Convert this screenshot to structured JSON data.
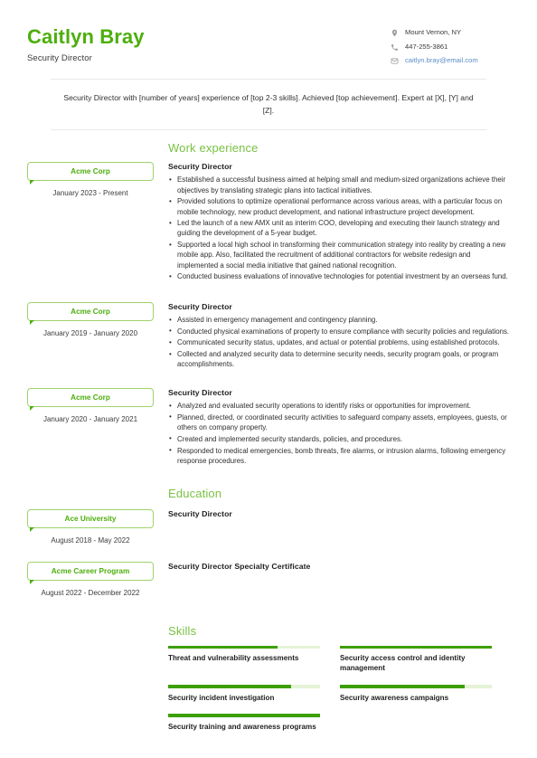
{
  "header": {
    "full_name": "Caitlyn Bray",
    "job_title": "Security Director",
    "contacts": [
      {
        "icon": "location-pin-icon",
        "text": "Mount Vernon, NY",
        "type": "text"
      },
      {
        "icon": "phone-icon",
        "text": "447-255-3861",
        "type": "text"
      },
      {
        "icon": "envelope-icon",
        "text": "caitlyn.bray@email.com",
        "type": "link"
      }
    ]
  },
  "summary": {
    "text": "Security Director with [number of years] experience of [top 2-3 skills]. Achieved [top achievement]. Expert at [X], [Y] and [Z]."
  },
  "sections": {
    "work_experience": {
      "title": "Work experience",
      "entries": [
        {
          "company": "Acme Corp",
          "dates": "January 2023 - Present",
          "role": "Security Director",
          "bullets": [
            "Established a successful business aimed at helping small and medium-sized organizations achieve their objectives by translating strategic plans into tactical initiatives.",
            "Provided solutions to optimize operational performance across various areas, with a particular focus on mobile technology, new product development, and national infrastructure project development.",
            "Led the launch of a new AMX unit as interim COO, developing and executing their launch strategy and guiding the development of a 5-year budget.",
            "Supported a local high school in transforming their communication strategy into reality by creating a new mobile app. Also, facilitated the recruitment of additional contractors for website redesign and implemented a social media initiative that gained national recognition.",
            "Conducted business evaluations of innovative technologies for potential investment by an overseas fund."
          ]
        },
        {
          "company": "Acme Corp",
          "dates": "January 2019 - January 2020",
          "role": "Security Director",
          "bullets": [
            "Assisted in emergency management and contingency planning.",
            "Conducted physical examinations of property to ensure compliance with security policies and regulations.",
            "Communicated security status, updates, and actual or potential problems, using established protocols.",
            "Collected and analyzed security data to determine security needs, security program goals, or program accomplishments."
          ]
        },
        {
          "company": "Acme Corp",
          "dates": "January 2020 - January 2021",
          "role": "Security Director",
          "bullets": [
            "Analyzed and evaluated security operations to identify risks or opportunities for improvement.",
            "Planned, directed, or coordinated security activities to safeguard company assets, employees, guests, or others on company property.",
            "Created and implemented security standards, policies, and procedures.",
            "Responded to medical emergencies, bomb threats, fire alarms, or intrusion alarms, following emergency response procedures."
          ]
        }
      ]
    },
    "education": {
      "title": "Education",
      "entries": [
        {
          "institution": "Ace University",
          "dates": "August 2018 - May 2022",
          "degree": "Security Director"
        },
        {
          "institution": "Acme Career Program",
          "dates": "August 2022 - December 2022",
          "degree": "Security Director Specialty Certificate"
        }
      ]
    },
    "skills": {
      "title": "Skills",
      "items": [
        {
          "label": "Threat and vulnerability assessments",
          "level": 72
        },
        {
          "label": "Security access control and identity management",
          "level": 100
        },
        {
          "label": "Security incident investigation",
          "level": 81
        },
        {
          "label": "Security awareness campaigns",
          "level": 82
        },
        {
          "label": "Security training and awareness programs",
          "level": 100
        }
      ]
    }
  },
  "colors": {
    "accent_green": "#7ac143",
    "name_green": "#4caf0b",
    "bar_fill": "#3c9f00",
    "bar_track": "#e4f3d6",
    "link_blue": "#5b8fc7"
  }
}
